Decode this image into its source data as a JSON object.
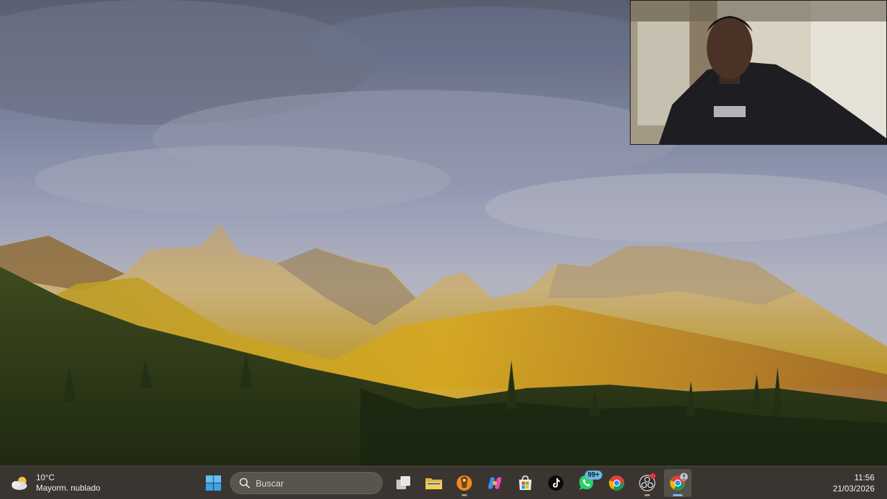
{
  "weather": {
    "temperature": "10°C",
    "condition": "Mayorm. nublado",
    "icon": "partly-cloudy-icon"
  },
  "search": {
    "placeholder": "Buscar"
  },
  "taskbar_apps": [
    {
      "name": "task-view",
      "icon": "task-view-icon"
    },
    {
      "name": "file-explorer",
      "icon": "folder-icon"
    },
    {
      "name": "fl-studio",
      "icon": "fl-studio-icon"
    },
    {
      "name": "copilot",
      "icon": "copilot-icon"
    },
    {
      "name": "microsoft-store",
      "icon": "store-icon"
    },
    {
      "name": "tiktok",
      "icon": "tiktok-icon"
    },
    {
      "name": "whatsapp",
      "icon": "whatsapp-icon",
      "badge": "99+"
    },
    {
      "name": "chrome",
      "icon": "chrome-icon"
    },
    {
      "name": "obs",
      "icon": "obs-icon"
    },
    {
      "name": "chrome-profile",
      "icon": "chrome-icon",
      "active": true
    }
  ],
  "clock": {
    "time": "11:56",
    "date": "21/03/2026"
  },
  "colors": {
    "taskbar": "#3a3530",
    "accent": "#78b8f0",
    "badge": "#6fb5e0"
  }
}
